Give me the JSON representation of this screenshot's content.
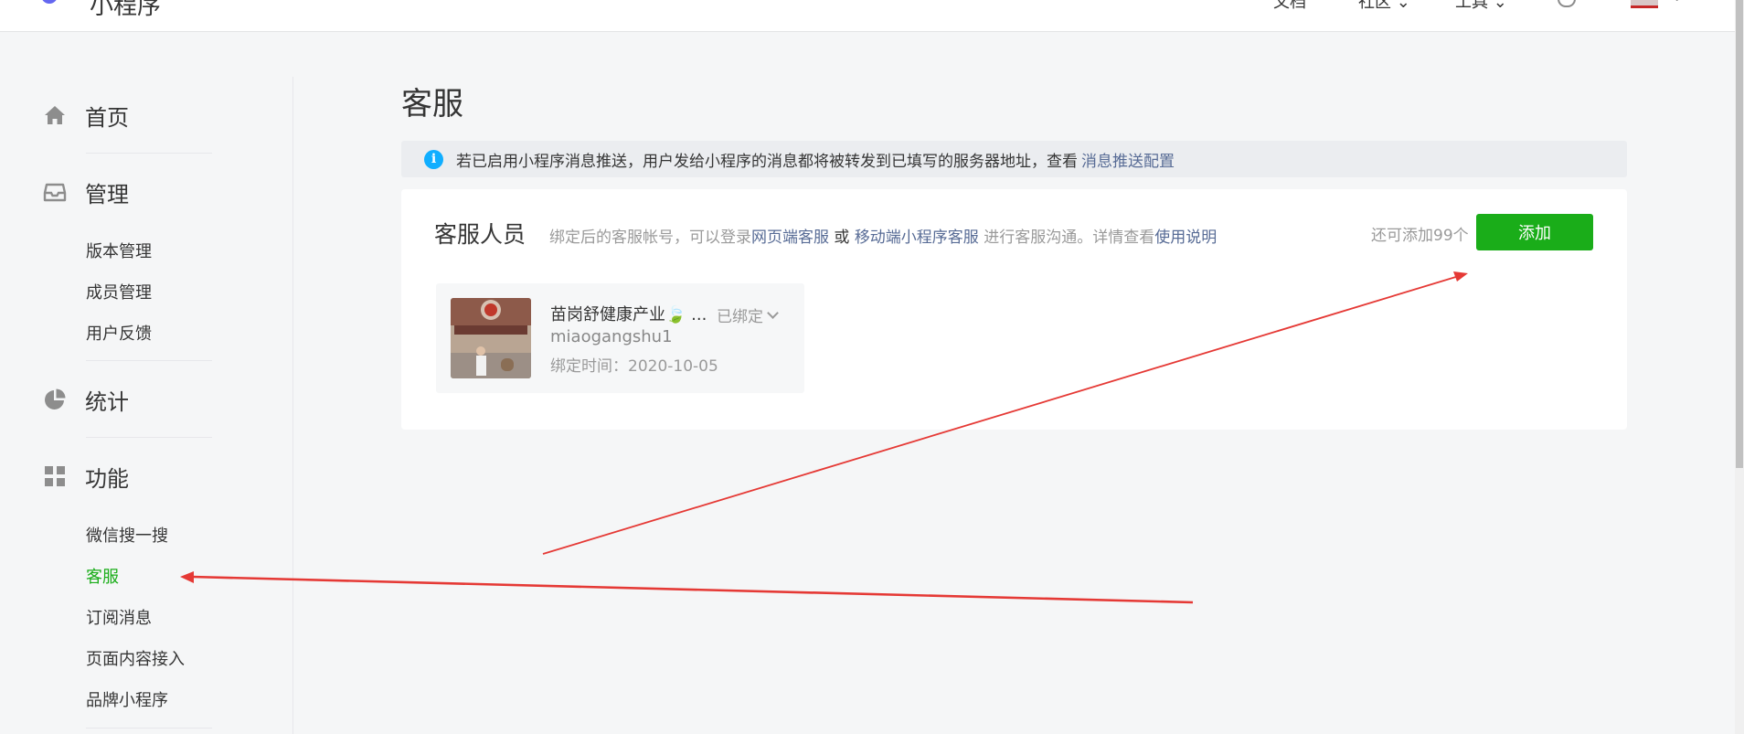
{
  "header": {
    "app_name": "小程序",
    "nav": [
      {
        "label": "文档",
        "caret": ""
      },
      {
        "label": "社区",
        "caret": "⌄"
      },
      {
        "label": "工具",
        "caret": "⌄"
      }
    ]
  },
  "sidebar": {
    "groups": [
      {
        "label": "首页",
        "icon": "home-icon"
      },
      {
        "label": "管理",
        "icon": "inbox-icon"
      },
      {
        "label": "统计",
        "icon": "pie-chart-icon"
      },
      {
        "label": "功能",
        "icon": "grid-icon"
      }
    ],
    "manage_items": [
      "版本管理",
      "成员管理",
      "用户反馈"
    ],
    "feature_items": [
      "微信搜一搜",
      "客服",
      "订阅消息",
      "页面内容接入",
      "品牌小程序"
    ],
    "active_item": "客服"
  },
  "main": {
    "title": "客服",
    "notice": {
      "text": "若已启用小程序消息推送，用户发给小程序的消息都将被转发到已填写的服务器地址，查看",
      "link": "消息推送配置"
    },
    "card": {
      "title": "客服人员",
      "desc_1": "绑定后的客服帐号，可以登录",
      "link_web": "网页端客服",
      "desc_or": " 或 ",
      "link_mobile": "移动端小程序客服",
      "desc_2": " 进行客服沟通。详情查看",
      "link_help": "使用说明",
      "quota": "还可添加99个",
      "add_label": "添加",
      "staff": {
        "name": "苗岗舒健康产业🍃 ...",
        "account": "miaogangshu1",
        "bind_time": "绑定时间：2020-10-05",
        "status": "已绑定"
      }
    }
  },
  "colors": {
    "accent_green": "#1aad19",
    "link_blue": "#576b95",
    "info_blue": "#10aeff",
    "annotation_red": "#e53935"
  }
}
